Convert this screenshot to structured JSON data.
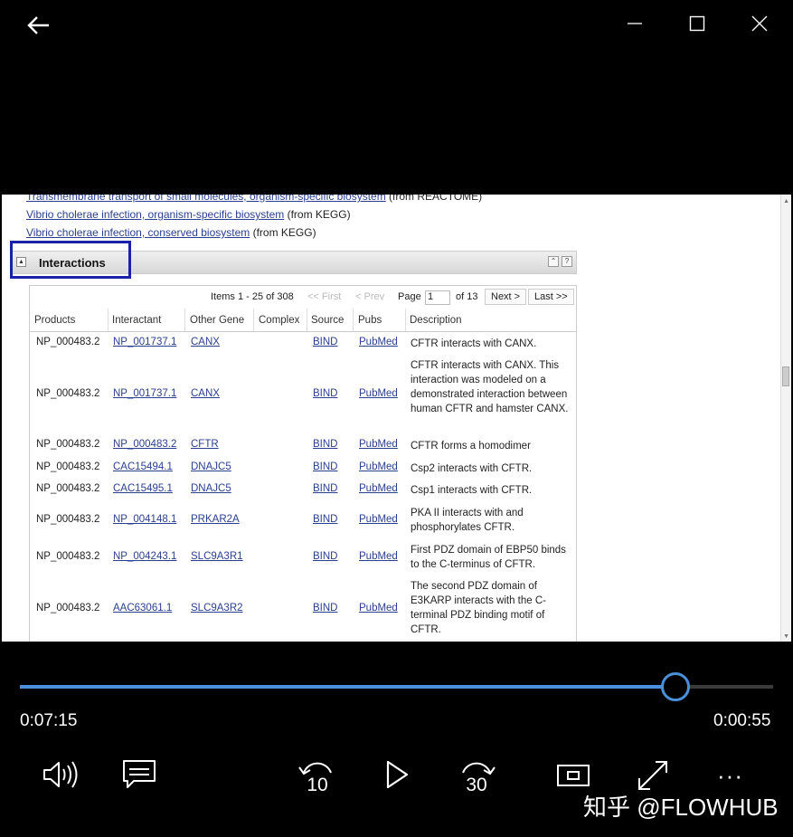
{
  "window": {
    "back_icon": "arrow-left-icon",
    "minimize_icon": "minimize-icon",
    "maximize_icon": "maximize-icon",
    "close_icon": "close-icon"
  },
  "video": {
    "pathways": [
      {
        "link": "Transmembrane transport of small molecules, organism-specific biosystem",
        "source": "(from REACTOME)"
      },
      {
        "link": "Vibrio cholerae infection, organism-specific biosystem",
        "source": "(from KEGG)"
      },
      {
        "link": "Vibrio cholerae infection, conserved biosystem",
        "source": "(from KEGG)"
      }
    ],
    "section": {
      "toggle": "▲",
      "title": "Interactions",
      "btn_collapse": "⌃",
      "btn_help": "?"
    },
    "pager": {
      "items": "Items 1 - 25 of 308",
      "first": "<< First",
      "prev": "< Prev",
      "page_label": "Page",
      "page_value": "1",
      "of": "of 13",
      "next": "Next >",
      "last": "Last >>"
    },
    "columns": [
      "Products",
      "Interactant",
      "Other Gene",
      "Complex",
      "Source",
      "Pubs",
      "Description"
    ],
    "rows": [
      {
        "product": "NP_000483.2",
        "interactant": "NP_001737.1",
        "gene": "CANX",
        "source": "BIND",
        "pubs": "PubMed",
        "desc": "CFTR interacts with CANX."
      },
      {
        "product": "NP_000483.2",
        "interactant": "NP_001737.1",
        "gene": "CANX",
        "source": "BIND",
        "pubs": "PubMed",
        "desc": "CFTR interacts with CANX. This interaction was modeled on a demonstrated interaction between human CFTR and hamster CANX."
      },
      {
        "product": "NP_000483.2",
        "interactant": "NP_000483.2",
        "gene": "CFTR",
        "source": "BIND",
        "pubs": "PubMed",
        "desc": "CFTR forms a homodimer"
      },
      {
        "product": "NP_000483.2",
        "interactant": "CAC15494.1",
        "gene": "DNAJC5",
        "source": "BIND",
        "pubs": "PubMed",
        "desc": "Csp2 interacts with CFTR."
      },
      {
        "product": "NP_000483.2",
        "interactant": "CAC15495.1",
        "gene": "DNAJC5",
        "source": "BIND",
        "pubs": "PubMed",
        "desc": "Csp1 interacts with CFTR."
      },
      {
        "product": "NP_000483.2",
        "interactant": "NP_004148.1",
        "gene": "PRKAR2A",
        "source": "BIND",
        "pubs": "PubMed",
        "desc": "PKA II interacts with and phosphorylates CFTR."
      },
      {
        "product": "NP_000483.2",
        "interactant": "NP_004243.1",
        "gene": "SLC9A3R1",
        "source": "BIND",
        "pubs": "PubMed",
        "desc": "First PDZ domain of EBP50 binds to the C-terminus of CFTR."
      },
      {
        "product": "NP_000483.2",
        "interactant": "AAC63061.1",
        "gene": "SLC9A3R2",
        "source": "BIND",
        "pubs": "PubMed",
        "desc": "The second PDZ domain of E3KARP interacts with the C-terminal PDZ binding motif of CFTR."
      }
    ]
  },
  "player": {
    "elapsed": "0:07:15",
    "remaining": "0:00:55",
    "progress_fraction": 0.87,
    "accent_color": "#4a90d9",
    "skip_back_label": "10",
    "skip_forward_label": "30",
    "more_label": "···"
  },
  "watermark": "知乎 @FLOWHUB"
}
